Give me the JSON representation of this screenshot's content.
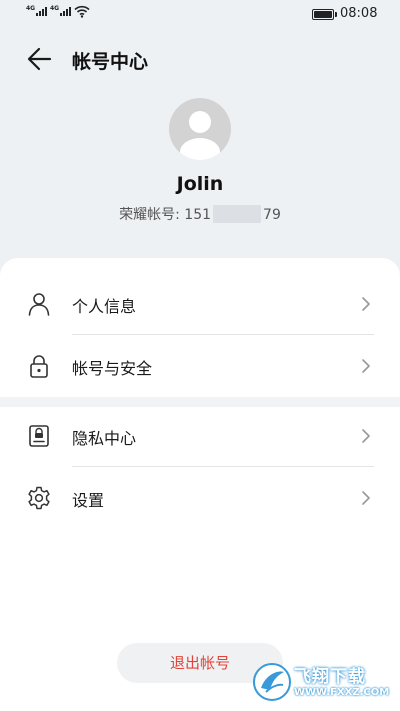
{
  "status_bar": {
    "sim1_tag": "4G",
    "sim2_tag": "4G",
    "time": "08:08"
  },
  "header": {
    "title": "帐号中心"
  },
  "profile": {
    "name": "Jolin",
    "account_label": "荣耀帐号: ",
    "account_prefix": "151",
    "account_suffix": "79"
  },
  "menu": {
    "group1": [
      {
        "label": "个人信息",
        "icon": "person-icon"
      },
      {
        "label": "帐号与安全",
        "icon": "lock-icon"
      }
    ],
    "group2": [
      {
        "label": "隐私中心",
        "icon": "privacy-id-card-icon"
      },
      {
        "label": "设置",
        "icon": "gear-icon"
      }
    ]
  },
  "logout": {
    "label": "退出帐号"
  },
  "watermark": {
    "text": "飞翔下载",
    "url": "WWW.FXXZ.COM"
  },
  "colors": {
    "top_background": "#eef1f4",
    "logout_text": "#e0443a",
    "watermark_blue": "#3a9ad9"
  }
}
